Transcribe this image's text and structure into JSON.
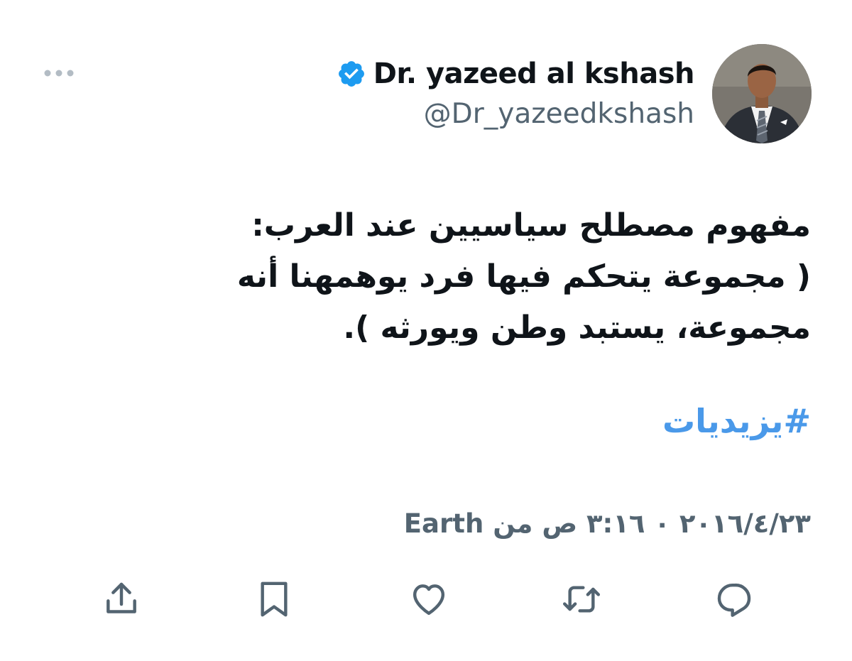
{
  "author": {
    "display_name": "Dr. yazeed al kshash",
    "handle": "@Dr_yazeedkshash",
    "verified": true
  },
  "tweet": {
    "lines": [
      "مفهوم مصطلح سياسيين عند العرب:",
      "( مجموعة يتحكم فيها فرد يوهمهنا أنه",
      "مجموعة، يستبد وطن ويورثه )."
    ],
    "hashtag": "#يزيديات"
  },
  "meta": {
    "date": "٢٠١٦/٤/٢٣",
    "separator": "٠",
    "time": "٣:١٦ ص",
    "via": "من",
    "source": "Earth"
  },
  "colors": {
    "text": "#0f1419",
    "secondary": "#536471",
    "link": "#4a99e9",
    "verified_badge": "#1d9bf0"
  },
  "icons": [
    "more-icon",
    "verified-icon",
    "share-icon",
    "bookmark-icon",
    "like-icon",
    "retweet-icon",
    "reply-icon"
  ]
}
